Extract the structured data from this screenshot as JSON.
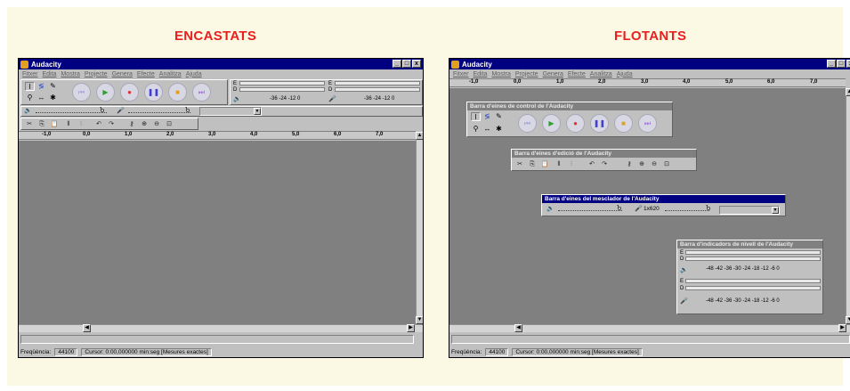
{
  "headings": {
    "left": "ENCASTATS",
    "right": "FLOTANTS"
  },
  "app_title": "Audacity",
  "window_controls": [
    "_",
    "□",
    "x"
  ],
  "menu": [
    "Fitxer",
    "Edita",
    "Mostra",
    "Projecte",
    "Genera",
    "Efecte",
    "Analitza",
    "Ajuda"
  ],
  "icons": {
    "tools": [
      "ibeam-tool-icon",
      "envelope-tool-icon",
      "draw-tool-icon",
      "zoom-tool-icon",
      "timeshift-tool-icon",
      "multi-tool-icon"
    ],
    "transport": [
      "skip-start-icon",
      "play-icon",
      "record-icon",
      "pause-icon",
      "stop-icon",
      "skip-end-icon"
    ],
    "edit": [
      "cut-icon",
      "copy-icon",
      "paste-icon",
      "trim-icon",
      "silence-icon",
      "undo-icon",
      "redo-icon",
      "sync-lock-icon",
      "zoom-in-icon",
      "zoom-out-icon",
      "fit-icon"
    ]
  },
  "transport_colors": [
    "#a0a0d8",
    "#30a030",
    "#e03030",
    "#4040d0",
    "#e0a020",
    "#a070d8"
  ],
  "meters": {
    "left_label": "E",
    "right_label": "D",
    "scale": "-36  -24  -12  0",
    "scale_full": "-48  -42  -36  -30  -24  -18  -12  -6  0"
  },
  "mixer": {
    "slider_value": "1x620"
  },
  "ruler": [
    "-1,0",
    "0,0",
    "1,0",
    "2,0",
    "3,0",
    "4,0",
    "5,0",
    "6,0",
    "7,0"
  ],
  "status": {
    "rate_label": "Freqüència:",
    "rate_value": "44100",
    "cursor_text": "Cursor: 0:00,000000 min:seg  [Mesures exactes]"
  },
  "floating_titles": {
    "control": "Barra d'eines de control de l'Audacity",
    "edit": "Barra d'eines d'edició de l'Audacity",
    "mixer": "Barra d'eines del mesclador de l'Audacity",
    "meter": "Barra d'indicadors de nivell de l'Audacity"
  }
}
